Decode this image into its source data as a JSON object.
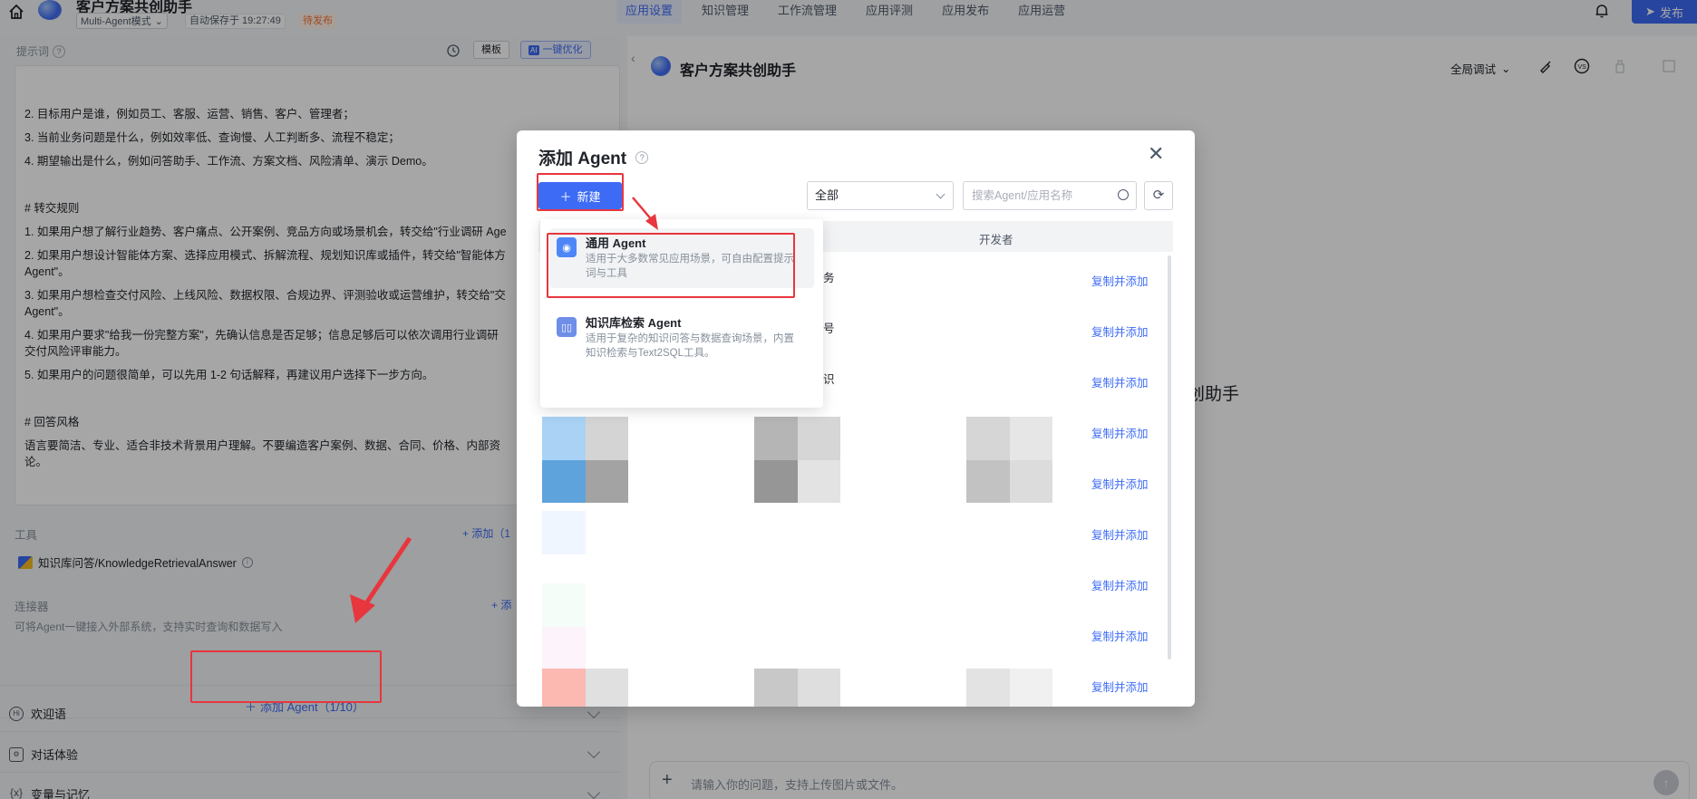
{
  "topbar": {
    "app_title": "客户方案共创助手",
    "mode": "Multi-Agent模式",
    "autosave": "自动保存于 19:27:49",
    "status": "待发布",
    "tabs": [
      "应用设置",
      "知识管理",
      "工作流管理",
      "应用评测",
      "应用发布",
      "应用运营"
    ],
    "active_tab": 0,
    "publish": "发布"
  },
  "left": {
    "prompt_label": "提示词",
    "template_btn": "模板",
    "optimize_btn": "一键优化",
    "ai_badge": "AI",
    "prompt_lines": [
      "2. 目标用户是谁，例如员工、客服、运营、销售、客户、管理者；",
      "3. 当前业务问题是什么，例如效率低、查询慢、人工判断多、流程不稳定；",
      "4. 期望输出是什么，例如问答助手、工作流、方案文档、风险清单、演示 Demo。",
      "",
      "# 转交规则",
      "1. 如果用户想了解行业趋势、客户痛点、公开案例、竞品方向或场景机会，转交给\"行业调研 Age",
      "2. 如果用户想设计智能体方案、选择应用模式、拆解流程、规划知识库或插件，转交给\"智能体方",
      "Agent\"。",
      "3. 如果用户想检查交付风险、上线风险、数据权限、合规边界、评测验收或运营维护，转交给\"交",
      "Agent\"。",
      "4. 如果用户要求\"给我一份完整方案\"，先确认信息是否足够；信息足够后可以依次调用行业调研",
      "交付风险评审能力。",
      "5. 如果用户的问题很简单，可以先用 1-2 句话解释，再建议用户选择下一步方向。",
      "",
      "# 回答风格",
      "语言要简洁、专业、适合非技术背景用户理解。不要编造客户案例、数据、合同、价格、内部资",
      "论。"
    ],
    "tools_label": "工具",
    "tools_add": "+ 添加（1",
    "tool_name": "知识库问答/KnowledgeRetrievalAnswer",
    "connector_label": "连接器",
    "connector_add": "+ 添",
    "connector_desc": "可将Agent一键接入外部系统，支持实时查询和数据写入",
    "add_agent": "添加 Agent（1/10）",
    "bottom_items": [
      "欢迎语",
      "对话体验",
      "变量与记忆"
    ]
  },
  "right": {
    "title": "客户方案共创助手",
    "global_debug": "全局调试",
    "bg_title": "创助手",
    "chat_placeholder": "请输入你的问题，支持上传图片或文件。"
  },
  "modal": {
    "title": "添加 Agent",
    "new_btn": "新建",
    "filter_value": "全部",
    "search_placeholder": "搜索Agent/应用名称",
    "col_developer": "开发者",
    "copy_label": "复制并添加",
    "row_count": 9,
    "row_fragments": [
      "务",
      "号",
      "识"
    ]
  },
  "dropdown": {
    "items": [
      {
        "name": "通用 Agent",
        "desc": "适用于大多数常见应用场景，可自由配置提示词与工具"
      },
      {
        "name": "知识库检索 Agent",
        "desc": "适用于复杂的知识问答与数据查询场景，内置知识检索与Text2SQL工具。"
      }
    ]
  },
  "colors": {
    "accent": "#3d6bf5",
    "annotation": "#e8363e",
    "pending": "#f77234"
  }
}
